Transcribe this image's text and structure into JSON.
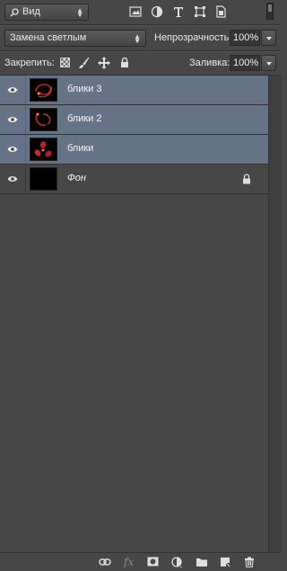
{
  "filter": {
    "kind_label": "Вид"
  },
  "blend": {
    "mode": "Замена светлым",
    "opacity_label": "Непрозрачность:",
    "opacity_value": "100%"
  },
  "lock": {
    "label": "Закрепить:",
    "fill_label": "Заливка:",
    "fill_value": "100%"
  },
  "layers": [
    {
      "name": "блики 3",
      "selected": true,
      "thumb": "swirl"
    },
    {
      "name": "блики 2",
      "selected": true,
      "thumb": "swirl"
    },
    {
      "name": "блики",
      "selected": true,
      "thumb": "petals"
    },
    {
      "name": "Фон",
      "selected": false,
      "thumb": "black",
      "locked": true
    }
  ],
  "colors": {
    "panel": "#474747",
    "selected": "#667387"
  }
}
